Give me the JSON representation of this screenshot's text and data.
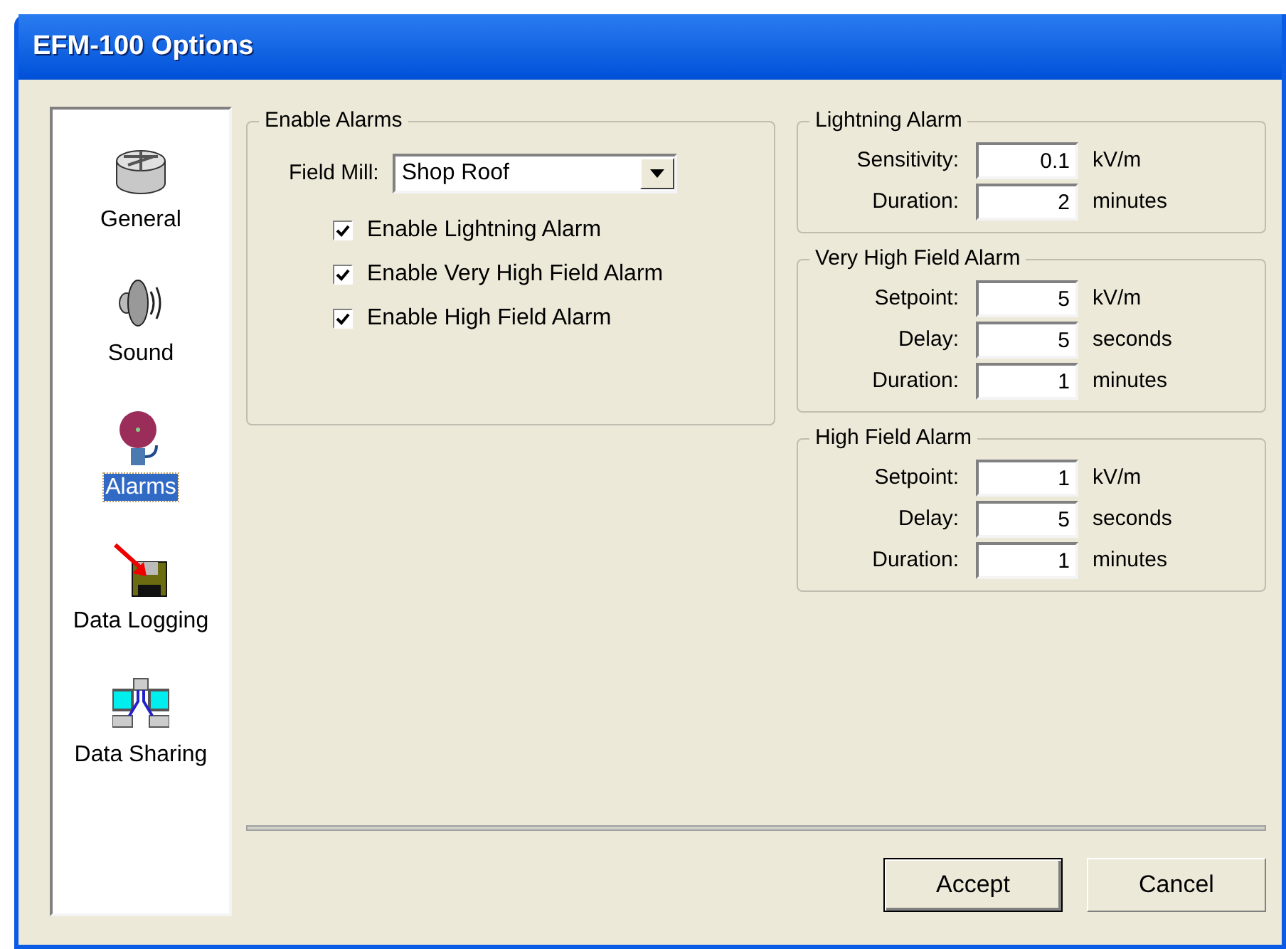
{
  "window": {
    "title": "EFM-100 Options"
  },
  "sidebar": {
    "items": [
      {
        "label": "General",
        "kind": "general",
        "selected": false
      },
      {
        "label": "Sound",
        "kind": "sound",
        "selected": false
      },
      {
        "label": "Alarms",
        "kind": "alarms",
        "selected": true
      },
      {
        "label": "Data Logging",
        "kind": "logging",
        "selected": false
      },
      {
        "label": "Data Sharing",
        "kind": "sharing",
        "selected": false
      }
    ]
  },
  "enable_alarms": {
    "title": "Enable Alarms",
    "field_mill": {
      "label": "Field Mill:",
      "value": "Shop Roof"
    },
    "checkboxes": [
      {
        "label": "Enable Lightning Alarm",
        "checked": true
      },
      {
        "label": "Enable Very High Field Alarm",
        "checked": true
      },
      {
        "label": "Enable High Field Alarm",
        "checked": true
      }
    ]
  },
  "alarm_groups": [
    {
      "title": "Lightning Alarm",
      "rows": [
        {
          "label": "Sensitivity:",
          "value": "0.1",
          "unit": "kV/m"
        },
        {
          "label": "Duration:",
          "value": "2",
          "unit": "minutes"
        }
      ]
    },
    {
      "title": "Very High Field Alarm",
      "rows": [
        {
          "label": "Setpoint:",
          "value": "5",
          "unit": "kV/m"
        },
        {
          "label": "Delay:",
          "value": "5",
          "unit": "seconds"
        },
        {
          "label": "Duration:",
          "value": "1",
          "unit": "minutes"
        }
      ]
    },
    {
      "title": "High Field Alarm",
      "rows": [
        {
          "label": "Setpoint:",
          "value": "1",
          "unit": "kV/m"
        },
        {
          "label": "Delay:",
          "value": "5",
          "unit": "seconds"
        },
        {
          "label": "Duration:",
          "value": "1",
          "unit": "minutes"
        }
      ]
    }
  ],
  "buttons": [
    {
      "label": "Accept",
      "default": true
    },
    {
      "label": "Cancel",
      "default": false
    }
  ]
}
